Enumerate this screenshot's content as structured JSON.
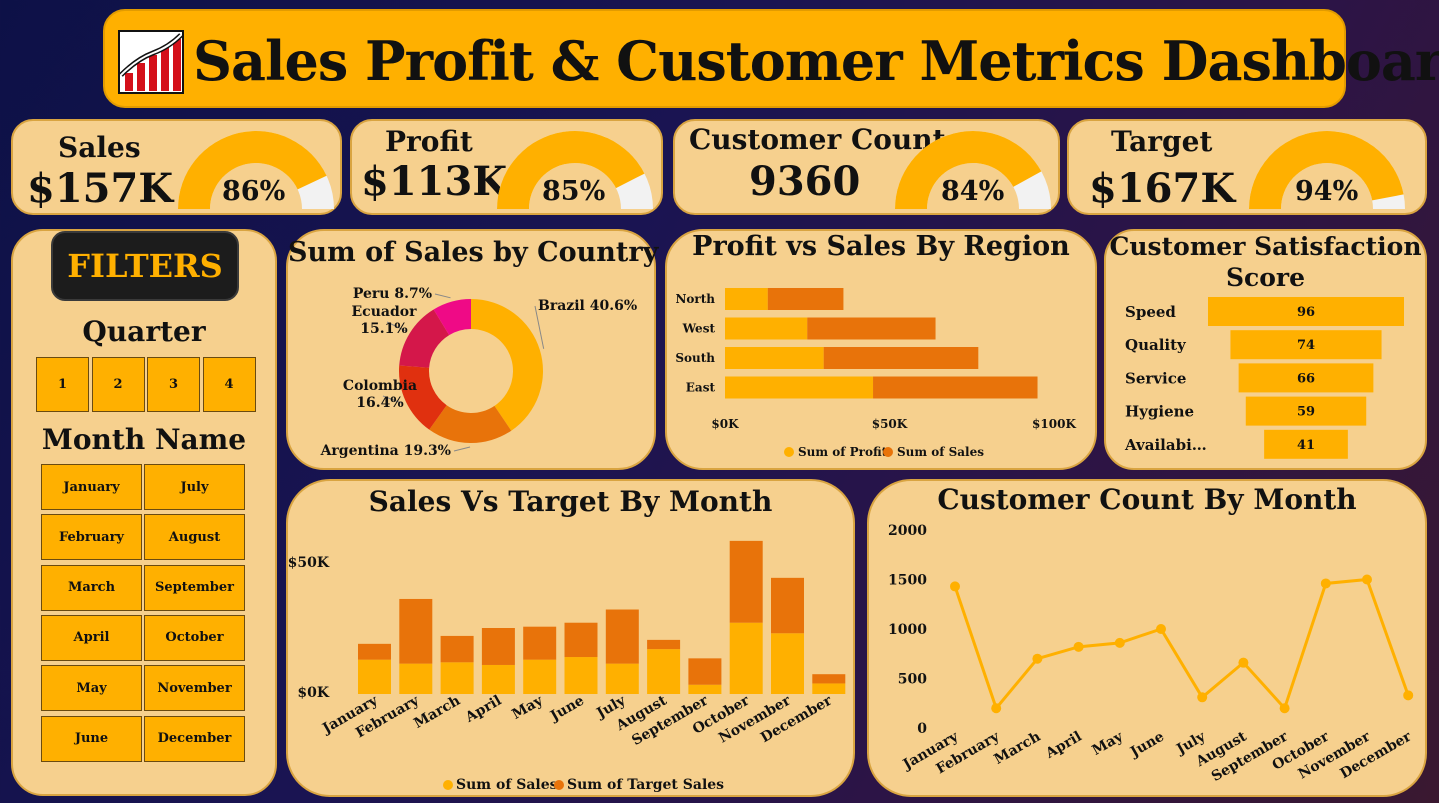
{
  "header": {
    "title": "Sales Profit & Customer Metrics Dashboard",
    "logo_icon": "sales-chart-logo-icon"
  },
  "kpis": {
    "sales": {
      "label": "Sales",
      "value": "$157K",
      "pct_label": "86%",
      "pct": 0.86
    },
    "profit": {
      "label": "Profit",
      "value": "$113K",
      "pct_label": "85%",
      "pct": 0.85
    },
    "customers": {
      "label": "Customer Count",
      "value": "9360",
      "pct_label": "84%",
      "pct": 0.84
    },
    "target": {
      "label": "Target",
      "value": "$167K",
      "pct_label": "94%",
      "pct": 0.94
    }
  },
  "colors": {
    "accent": "#ffb000",
    "dark_orange": "#e8730a",
    "panel": "#f6d08e",
    "gauge_rest": "#f2f2f2"
  },
  "filters": {
    "title": "FILTERS",
    "quarter_title": "Quarter",
    "quarters": [
      "1",
      "2",
      "3",
      "4"
    ],
    "month_title": "Month Name",
    "months_left": [
      "January",
      "February",
      "March",
      "April",
      "May",
      "June"
    ],
    "months_right": [
      "July",
      "August",
      "September",
      "October",
      "November",
      "December"
    ]
  },
  "chart_data": [
    {
      "type": "pie",
      "title": "Sum of Sales by Country",
      "categories": [
        "Brazil",
        "Argentina",
        "Colombia",
        "Ecuador",
        "Peru"
      ],
      "values": [
        40.6,
        19.3,
        16.4,
        15.1,
        8.7
      ],
      "labels": [
        "Brazil 40.6%",
        "Argentina 19.3%",
        "Colombia 16.4%",
        "Ecuador 15.1%",
        "Peru 8.7%"
      ],
      "colors": [
        "#ffb000",
        "#e8730a",
        "#e0300f",
        "#d4174a",
        "#ef0a86"
      ],
      "donut": true
    },
    {
      "type": "bar",
      "orientation": "horizontal",
      "stacked": true,
      "title": "Profit vs Sales By Region",
      "categories": [
        "North",
        "West",
        "South",
        "East"
      ],
      "series": [
        {
          "name": "Sum of Profit",
          "values": [
            13000,
            25000,
            30000,
            45000
          ],
          "color": "#ffb000"
        },
        {
          "name": "Sum of Sales",
          "values": [
            23000,
            39000,
            47000,
            50000
          ],
          "color": "#e8730a"
        }
      ],
      "xticks": [
        "$0K",
        "$50K",
        "$100K"
      ],
      "xlim": [
        0,
        107000
      ],
      "legend": "bottom"
    },
    {
      "type": "bar",
      "orientation": "horizontal",
      "title": "Customer Satisfaction Score",
      "categories": [
        "Speed",
        "Quality",
        "Service",
        "Hygiene",
        "Availabi…"
      ],
      "values": [
        96,
        74,
        66,
        59,
        41
      ],
      "color": "#ffb000",
      "funnel": true
    },
    {
      "type": "bar",
      "stacked": true,
      "title": "Sales Vs Target By Month",
      "categories": [
        "January",
        "February",
        "March",
        "April",
        "May",
        "June",
        "July",
        "August",
        "September",
        "October",
        "November",
        "December"
      ],
      "series": [
        {
          "name": "Sum of Sales",
          "values": [
            13000,
            11500,
            12000,
            11000,
            13000,
            14000,
            11500,
            17000,
            3500,
            27000,
            23000,
            4000
          ],
          "color": "#ffb000"
        },
        {
          "name": "Sum of Target Sales",
          "values": [
            6000,
            24500,
            10000,
            14000,
            12500,
            13000,
            20500,
            3500,
            10000,
            31000,
            21000,
            3500
          ],
          "color": "#e8730a"
        }
      ],
      "yticks": [
        "$0K",
        "$50K"
      ],
      "ylim": [
        0,
        50000
      ],
      "legend": "bottom"
    },
    {
      "type": "line",
      "title": "Customer Count By Month",
      "categories": [
        "January",
        "February",
        "March",
        "April",
        "May",
        "June",
        "July",
        "August",
        "September",
        "October",
        "November",
        "December"
      ],
      "values": [
        1430,
        200,
        700,
        820,
        860,
        1000,
        310,
        660,
        200,
        1460,
        1500,
        330
      ],
      "yticks": [
        "0",
        "500",
        "1000",
        "1500",
        "2000"
      ],
      "ylim": [
        0,
        2000
      ],
      "color": "#ffb000"
    }
  ]
}
